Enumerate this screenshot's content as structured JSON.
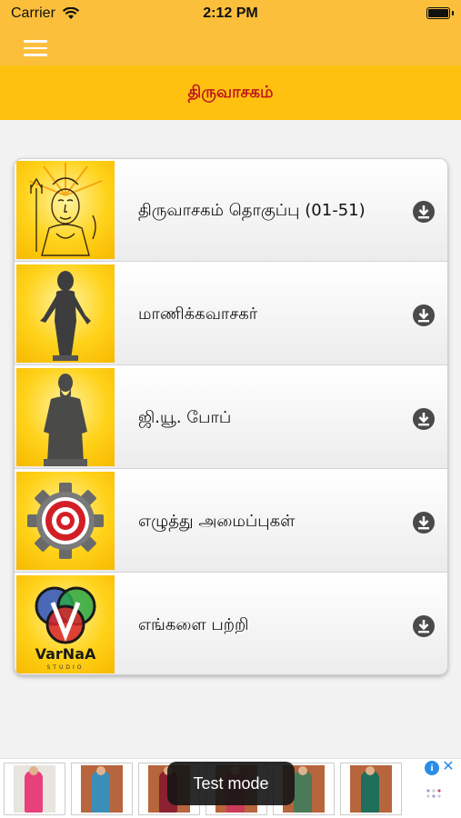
{
  "status_bar": {
    "carrier": "Carrier",
    "time": "2:12 PM"
  },
  "header": {
    "title": "திருவாசகம்"
  },
  "menu_items": [
    {
      "label": "திருவாசகம் தொகுப்பு (01-51)",
      "thumb_icon": "shiva-sketch-icon"
    },
    {
      "label": "மாணிக்கவாசகர்",
      "thumb_icon": "saint-statue-icon"
    },
    {
      "label": "ஜி.யூ. போப்",
      "thumb_icon": "gu-pope-statue-icon"
    },
    {
      "label": "எழுத்து அமைப்புகள்",
      "thumb_icon": "settings-gear-icon"
    },
    {
      "label": "எங்களை பற்றி",
      "thumb_icon": "varnaa-logo-icon"
    }
  ],
  "logo_text": {
    "brand": "VarNaA",
    "sub": "STUDIO"
  },
  "ad": {
    "toast": "Test mode",
    "info_glyph": "i",
    "close_glyph": "✕"
  },
  "colors": {
    "header_bg": "#fbbf3c",
    "title_bar_bg": "#ffc10f",
    "title_text": "#c0181c",
    "thumb_bg": "#ffd21a",
    "download_icon": "#4a4a4a"
  }
}
